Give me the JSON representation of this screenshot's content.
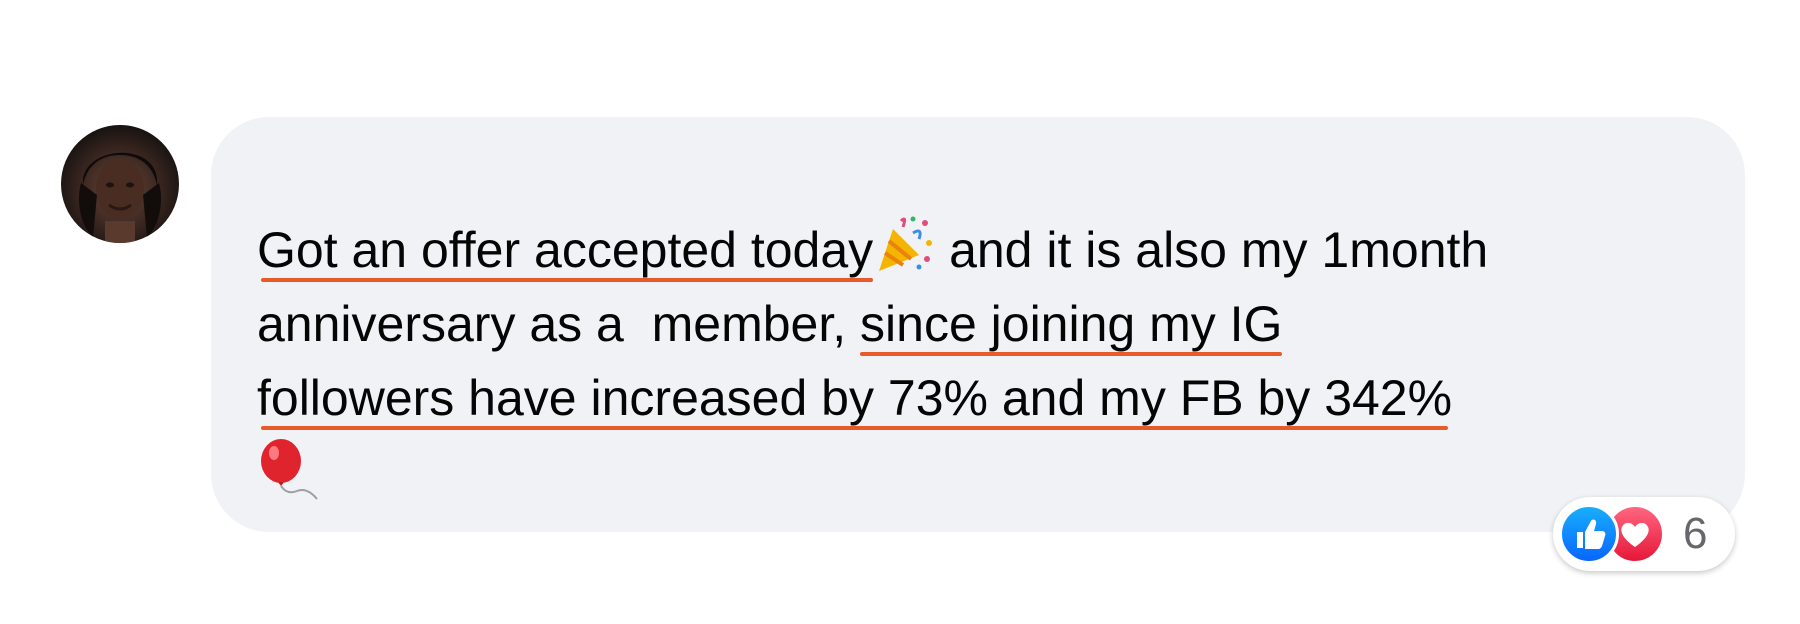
{
  "comment": {
    "line1_a": "Got an offer accepted today",
    "line1_emoji": "party-popper",
    "line1_b": " and it is also my 1month",
    "line2_a": "anniversary as a  member, ",
    "line2_b": "since joining my IG",
    "line3": "followers have increased by 73% and my FB by 342%",
    "line4_emoji": "balloon"
  },
  "reactions": {
    "types": [
      "like",
      "love"
    ],
    "count": "6"
  },
  "colors": {
    "bubble": "#f0f2f5",
    "underline": "#e85a2a",
    "like": "#0866ff",
    "love": "#e61739",
    "count_text": "#65676b"
  }
}
